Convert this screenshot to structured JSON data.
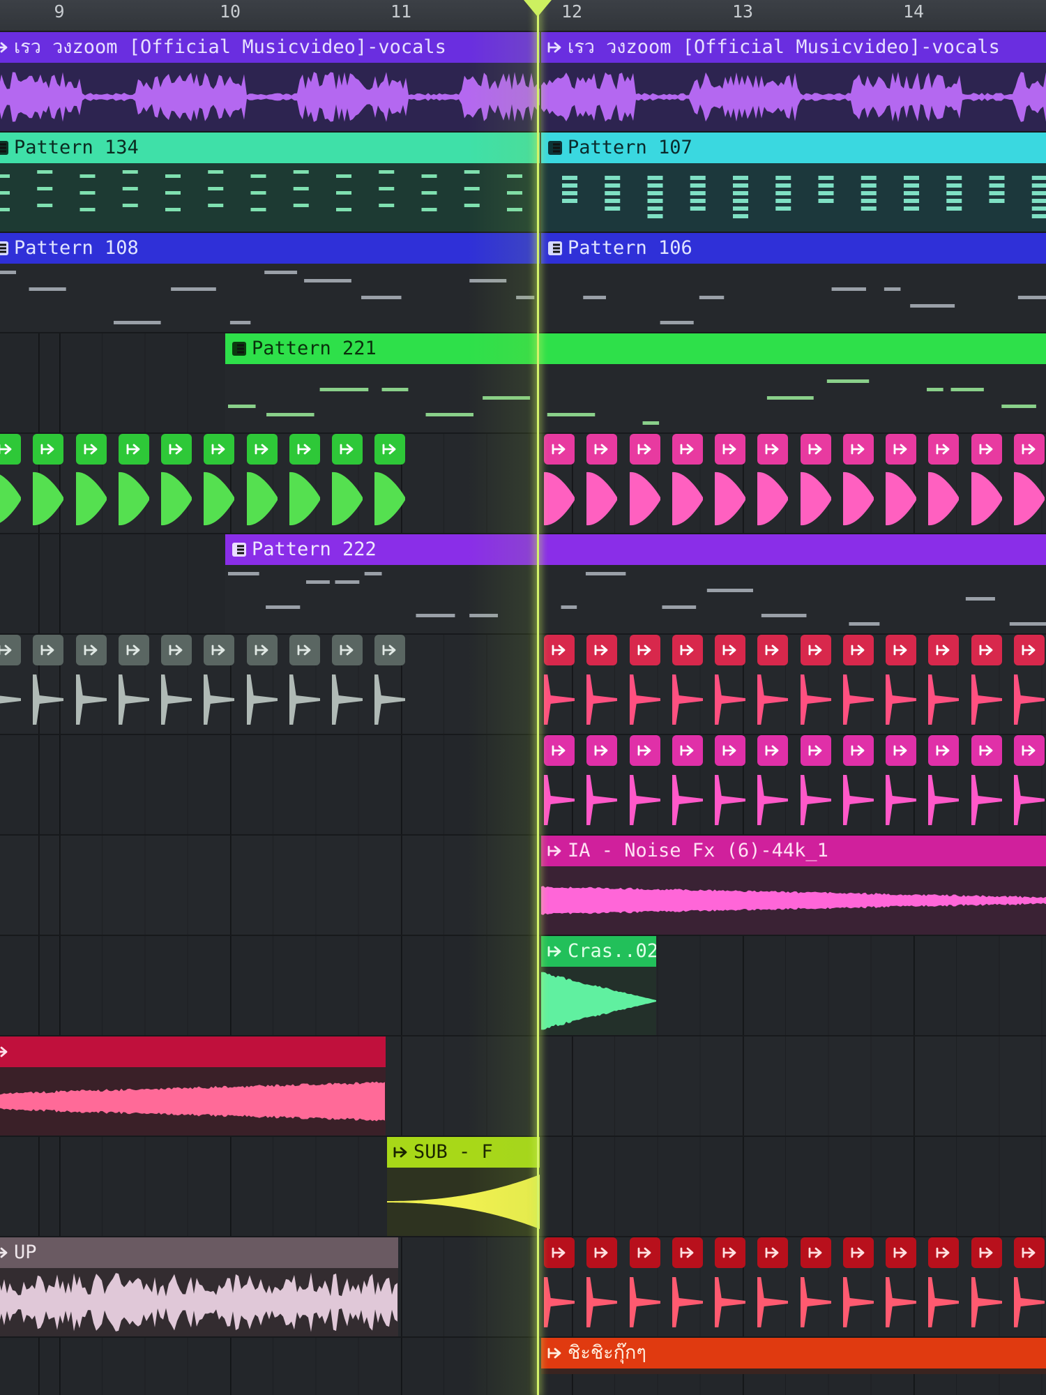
{
  "ruler": {
    "bars": [
      {
        "label": "9",
        "bar": 9
      },
      {
        "label": "10",
        "bar": 10
      },
      {
        "label": "11",
        "bar": 11
      },
      {
        "label": "12",
        "bar": 12
      },
      {
        "label": "13",
        "bar": 13
      },
      {
        "label": "14",
        "bar": 14
      }
    ]
  },
  "playhead": {
    "bar": 11.8
  },
  "icons": {
    "audio_clip": "audio-clip-icon",
    "pattern_clip": "pattern-clip-icon",
    "playhead": "playhead-marker-icon"
  },
  "tracks": [
    {
      "clips": [
        {
          "kind": "audio",
          "label": "เรว วงzoom [Official Musicvideo]-vocals",
          "start": 8.58,
          "end": 11.82,
          "color": "#6a2ee0",
          "body": "#2d2450",
          "wave": "#b468f0",
          "text": "#e8e0ff",
          "render": "vocal"
        },
        {
          "kind": "audio",
          "label": "เรว วงzoom [Official Musicvideo]-vocals",
          "start": 11.82,
          "end": 15.0,
          "color": "#6a2ee0",
          "body": "#2d2450",
          "wave": "#b468f0",
          "text": "#e8e0ff",
          "render": "vocal"
        }
      ]
    },
    {
      "clips": [
        {
          "kind": "pattern",
          "label": "Pattern 134",
          "start": 8.58,
          "end": 11.82,
          "color": "#3fe0a8",
          "body": "#1d3a33",
          "wave": "#7fe0b0",
          "text": "#0a2a20",
          "render": "steps"
        },
        {
          "kind": "pattern",
          "label": "Pattern 107",
          "start": 11.82,
          "end": 15.0,
          "color": "#3ad8e0",
          "body": "#1c383c",
          "wave": "#7fe0c4",
          "text": "#0a2a2c",
          "render": "chords"
        }
      ]
    },
    {
      "clips": [
        {
          "kind": "pattern",
          "label": "Pattern 108",
          "start": 8.58,
          "end": 11.82,
          "color": "#2f30d8",
          "body": "#25282c",
          "wave": "#9aa0a8",
          "text": "#e0e4ff",
          "render": "notes"
        },
        {
          "kind": "pattern",
          "label": "Pattern 106",
          "start": 11.82,
          "end": 15.0,
          "color": "#2f30d8",
          "body": "#25282c",
          "wave": "#9aa0a8",
          "text": "#e0e4ff",
          "render": "notes"
        }
      ]
    },
    {
      "clips": [
        {
          "kind": "pattern",
          "label": "Pattern 221",
          "start": 9.97,
          "end": 15.0,
          "color": "#2ee04a",
          "body": "#25282c",
          "wave": "#8ad08a",
          "text": "#0a300c",
          "render": "notes"
        }
      ]
    },
    {
      "clips": [
        {
          "kind": "hits",
          "label": "",
          "start": 8.58,
          "end": 11.0,
          "color": "#2ec838",
          "body": "#25282c",
          "wave": "#55e050",
          "text": "#ffffff",
          "render": "kick"
        },
        {
          "kind": "hits",
          "label": "",
          "start": 11.82,
          "end": 15.0,
          "color": "#e83aa0",
          "body": "#25282c",
          "wave": "#ff60c0",
          "text": "#ffffff",
          "render": "kick"
        }
      ]
    },
    {
      "clips": [
        {
          "kind": "pattern",
          "label": "Pattern 222",
          "start": 9.97,
          "end": 15.0,
          "color": "#8a2ee8",
          "body": "#25282c",
          "wave": "#9aa0a8",
          "text": "#f0e8ff",
          "render": "notes"
        }
      ]
    },
    {
      "clips": [
        {
          "kind": "hits",
          "label": "",
          "start": 8.58,
          "end": 11.0,
          "color": "#5a6662",
          "body": "#25282c",
          "wave": "#b0bab6",
          "text": "#e0e8e4",
          "render": "shot"
        },
        {
          "kind": "hits",
          "label": "",
          "start": 11.82,
          "end": 15.0,
          "color": "#d8284c",
          "body": "#25282c",
          "wave": "#ff5080",
          "text": "#ffffff",
          "render": "shot"
        }
      ]
    },
    {
      "clips": [
        {
          "kind": "hits",
          "label": "",
          "start": 11.82,
          "end": 15.0,
          "color": "#e030a8",
          "body": "#25282c",
          "wave": "#ff58c8",
          "text": "#ffffff",
          "render": "shot"
        }
      ]
    },
    {
      "clips": [
        {
          "kind": "audio",
          "label": "IA - Noise Fx (6)-44k_1",
          "start": 11.82,
          "end": 15.0,
          "color": "#d0209c",
          "body": "#3a2234",
          "wave": "#ff66d8",
          "text": "#ffe0f4",
          "render": "noise"
        }
      ]
    },
    {
      "clips": [
        {
          "kind": "audio",
          "label": "Cras..02",
          "start": 11.82,
          "end": 12.5,
          "color": "#22c05a",
          "body": "#23302a",
          "wave": "#60f0a0",
          "text": "#e0ffe8",
          "render": "crash"
        }
      ]
    },
    {
      "clips": [
        {
          "kind": "audio",
          "label": "",
          "start": 8.58,
          "end": 10.92,
          "color": "#c0103c",
          "body": "#3a2028",
          "wave": "#ff6a98",
          "text": "#ffe0ea",
          "render": "sweep"
        }
      ]
    },
    {
      "clips": [
        {
          "kind": "audio",
          "label": "SUB - F",
          "start": 10.92,
          "end": 11.82,
          "color": "#a8d818",
          "body": "#2e3320",
          "wave": "#f0f050",
          "text": "#1a2400",
          "render": "sub"
        }
      ]
    },
    {
      "clips": [
        {
          "kind": "audio",
          "label": "UP",
          "start": 8.58,
          "end": 10.99,
          "color": "#6a5a62",
          "body": "#332c30",
          "wave": "#e0c8d8",
          "text": "#f0e8ec",
          "render": "riser"
        },
        {
          "kind": "hits",
          "label": "",
          "start": 11.82,
          "end": 15.0,
          "color": "#b8101c",
          "body": "#25282c",
          "wave": "#ff5a70",
          "text": "#ffe0e0",
          "render": "shot"
        }
      ]
    },
    {
      "clips": [
        {
          "kind": "audio",
          "label": "ชิะชิะกุ๊กๆ",
          "start": 11.82,
          "end": 15.0,
          "color": "#e03a10",
          "body": "#3a2420",
          "wave": "#ff8a60",
          "text": "#fff0e0",
          "render": "none"
        }
      ]
    }
  ]
}
